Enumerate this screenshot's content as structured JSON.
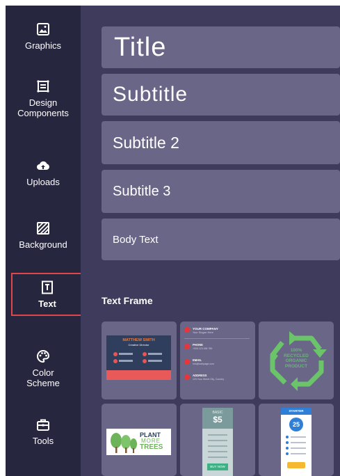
{
  "sidebar": {
    "items": [
      {
        "label": "Graphics",
        "icon": "image-icon"
      },
      {
        "label": "Design\nComponents",
        "icon": "components-icon"
      },
      {
        "label": "Uploads",
        "icon": "cloud-upload-icon"
      },
      {
        "label": "Background",
        "icon": "hatched-square-icon"
      },
      {
        "label": "Text",
        "icon": "text-frame-icon"
      },
      {
        "label": "Color\nScheme",
        "icon": "palette-icon"
      },
      {
        "label": "Tools",
        "icon": "toolbox-icon"
      }
    ],
    "active_index": 4
  },
  "text_styles": [
    {
      "label": "Title"
    },
    {
      "label": "Subtitle"
    },
    {
      "label": "Subtitle 2"
    },
    {
      "label": "Subtitle 3"
    },
    {
      "label": "Body Text"
    }
  ],
  "text_frame": {
    "heading": "Text Frame",
    "tiles": [
      {
        "name": "MATTHEW SMITH",
        "role": "Creative Director"
      },
      {
        "company": "YOUR COMPANY",
        "slogan": "Your Slogan Here",
        "rows": [
          "PHONE",
          "EMAIL",
          "ADDRESS"
        ],
        "values": [
          "+000 123 456 789",
          "info@webpage.com",
          "123 Your Street City, Country"
        ]
      },
      {
        "line1": "100%",
        "line2": "RECYCLED",
        "line3": "ORGANIC",
        "line4": "PRODUCT"
      },
      {
        "line1": "PLANT",
        "line2": "MORE",
        "line3": "TREES"
      },
      {
        "label": "BASIC",
        "price": "$5",
        "button": "BUY NOW"
      },
      {
        "label": "STARTER",
        "price": "25"
      }
    ]
  },
  "colors": {
    "sidebar": "#27263f",
    "panel": "#3e3b5c",
    "button": "#6a6688",
    "active_outline": "#e0474c"
  }
}
